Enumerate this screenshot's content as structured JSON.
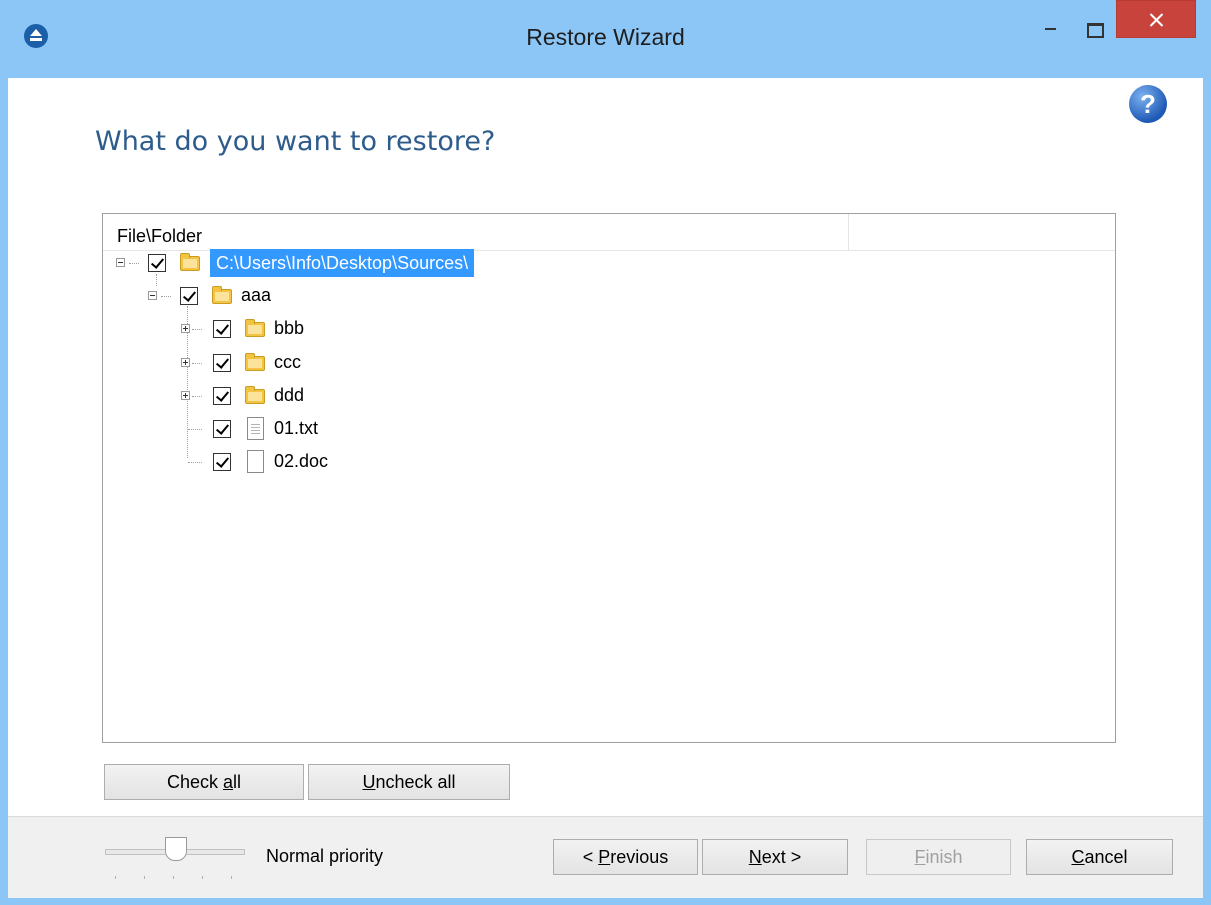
{
  "window": {
    "title": "Restore Wizard",
    "close_label": "×"
  },
  "page": {
    "heading": "What do you want to restore?",
    "help_label": "?"
  },
  "tree": {
    "column_header": "File\\Folder",
    "nodes": [
      {
        "label": "C:\\Users\\Info\\Desktop\\Sources\\",
        "type": "folder",
        "checked": true,
        "selected": true
      },
      {
        "label": "aaa",
        "type": "folder",
        "checked": true
      },
      {
        "label": "bbb",
        "type": "folder",
        "checked": true
      },
      {
        "label": "ccc",
        "type": "folder",
        "checked": true
      },
      {
        "label": "ddd",
        "type": "folder",
        "checked": true
      },
      {
        "label": "01.txt",
        "type": "file",
        "checked": true
      },
      {
        "label": "02.doc",
        "type": "file",
        "checked": true
      }
    ]
  },
  "buttons": {
    "check_all": {
      "pre": "Check ",
      "key": "a",
      "post": "ll"
    },
    "uncheck_all": {
      "pre": "",
      "key": "U",
      "post": "ncheck all"
    },
    "previous": {
      "pre": "< ",
      "key": "P",
      "post": "revious"
    },
    "next": {
      "pre": "",
      "key": "N",
      "post": "ext >"
    },
    "finish": {
      "pre": "",
      "key": "F",
      "post": "inish"
    },
    "cancel": {
      "pre": "",
      "key": "C",
      "post": "ancel"
    }
  },
  "priority": {
    "label": "Normal priority"
  }
}
